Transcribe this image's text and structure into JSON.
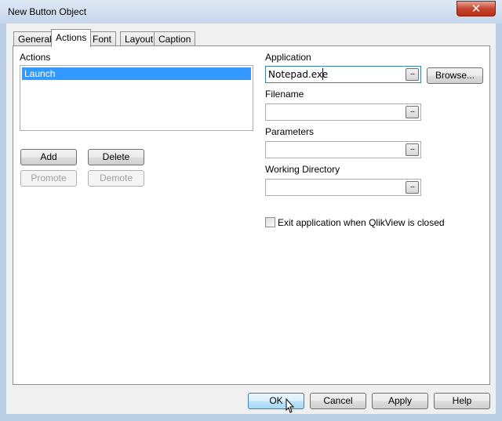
{
  "window": {
    "title": "New Button Object",
    "close_glyph": "✕"
  },
  "tabs": [
    {
      "label": "General",
      "active": false
    },
    {
      "label": "Actions",
      "active": true
    },
    {
      "label": "Font",
      "active": false
    },
    {
      "label": "Layout",
      "active": false
    },
    {
      "label": "Caption",
      "active": false
    }
  ],
  "actions": {
    "label": "Actions",
    "items": [
      "Launch"
    ],
    "selected": "Launch",
    "buttons": {
      "add": "Add",
      "delete": "Delete",
      "promote": "Promote",
      "demote": "Demote"
    }
  },
  "application": {
    "label": "Application",
    "value": "Notepad.exe",
    "browse_label": "Browse...",
    "dots": "..."
  },
  "filename": {
    "label": "Filename",
    "value": "",
    "dots": "..."
  },
  "parameters": {
    "label": "Parameters",
    "value": "",
    "dots": "..."
  },
  "working_directory": {
    "label": "Working Directory",
    "value": "",
    "dots": "..."
  },
  "exit_option": {
    "label": "Exit application when QlikView is closed",
    "checked": false
  },
  "footer": {
    "ok": "OK",
    "cancel": "Cancel",
    "apply": "Apply",
    "help": "Help"
  },
  "icons": {
    "close": "close-icon",
    "ellipsis": "ellipsis-icon",
    "cursor": "mouse-pointer-icon"
  }
}
